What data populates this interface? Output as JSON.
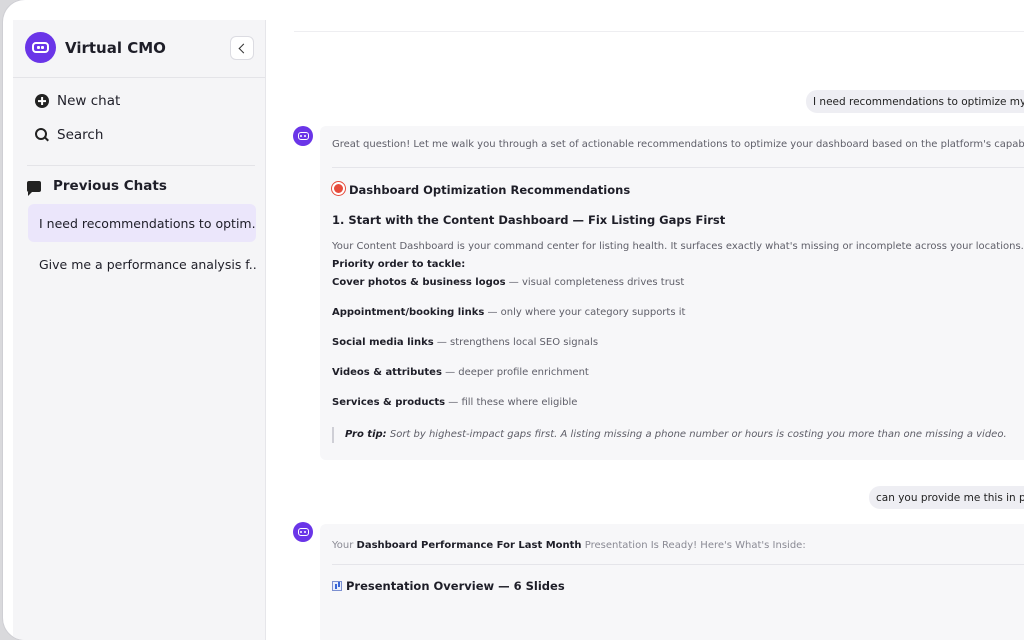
{
  "sidebar": {
    "app_name": "Virtual CMO",
    "new_chat": "New chat",
    "search": "Search",
    "previous_chats_heading": "Previous Chats",
    "chats": [
      {
        "label": "I need recommendations to optim..."
      },
      {
        "label": "Give me a performance analysis f..."
      }
    ]
  },
  "conversation": {
    "user_messages": [
      "I need recommendations to optimize my da",
      "can you provide me this in ppt"
    ],
    "bot_reply_1": {
      "intro": "Great question! Let me walk you through a set of actionable recommendations to optimize your dashboard based on the platform's capabilities.",
      "heading": "Dashboard Optimization Recommendations",
      "step_title": "1. Start with the Content Dashboard — Fix Listing Gaps First",
      "paragraph": "Your Content Dashboard is your command center for listing health. It surfaces exactly what's missing or incomplete across your locations.",
      "priority_label": "Priority order to tackle:",
      "items": [
        {
          "bold": "Cover photos & business logos",
          "rest": " — visual completeness drives trust"
        },
        {
          "bold": "Appointment/booking links",
          "rest": " — only where your category supports it"
        },
        {
          "bold": "Social media links",
          "rest": " — strengthens local SEO signals"
        },
        {
          "bold": "Videos & attributes",
          "rest": " — deeper profile enrichment"
        },
        {
          "bold": "Services & products",
          "rest": " — fill these where eligible"
        }
      ],
      "tip_label": "Pro tip:",
      "tip_text": " Sort by highest-impact gaps first. A listing missing a phone number or hours is costing you more than one missing a video."
    },
    "bot_reply_2": {
      "prefix": "Your ",
      "bold": "Dashboard Performance For Last Month",
      "suffix": " Presentation Is Ready! Here's What's Inside:",
      "overview_title": "Presentation Overview — 6 Slides"
    }
  },
  "colors": {
    "accent": "#6a35e8",
    "active_chat_bg": "#ebe6fb",
    "user_bubble_bg": "#eeeef3"
  },
  "icons": [
    "plus-circle-icon",
    "search-icon",
    "chat-bubbles-icon",
    "chevron-left-icon",
    "bot-icon",
    "target-emoji-icon",
    "bar-chart-emoji-icon"
  ]
}
